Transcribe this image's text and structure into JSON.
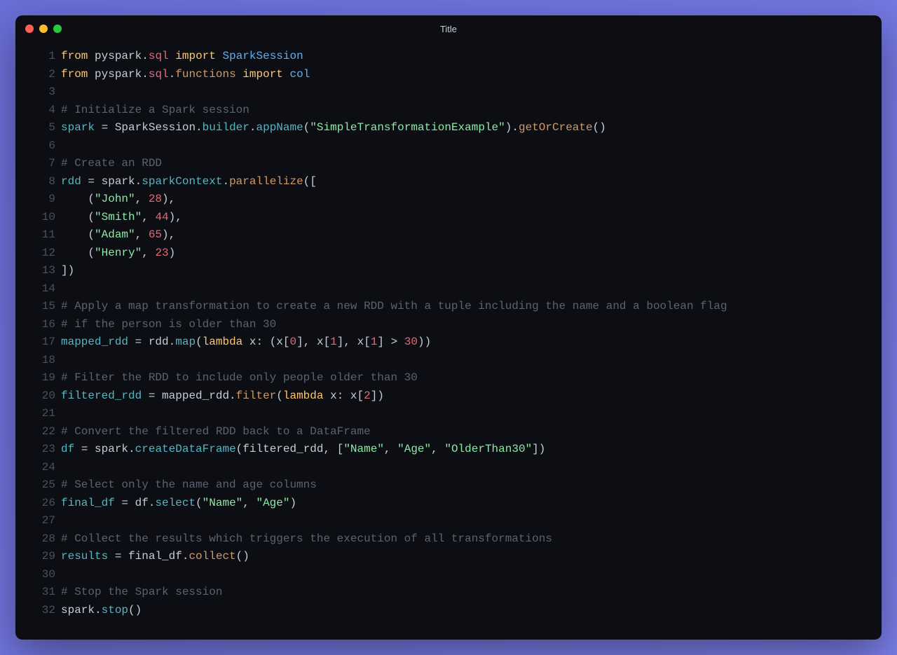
{
  "window": {
    "title": "Title"
  },
  "colors": {
    "bg": "#0d0e14",
    "gutter": "#4a5160",
    "comment": "#5c6370",
    "keyword": "#ffc66d",
    "string": "#8be9a5",
    "number": "#e06c75",
    "teal": "#56b6c2",
    "blue": "#61afef",
    "orange": "#d19a66",
    "default": "#c8ccd4"
  },
  "code": {
    "lines": [
      [
        {
          "t": "from ",
          "c": "kw"
        },
        {
          "t": "pyspark",
          "c": "mod"
        },
        {
          "t": ".",
          "c": "punct"
        },
        {
          "t": "sql",
          "c": "prop"
        },
        {
          "t": " ",
          "c": "mod"
        },
        {
          "t": "import ",
          "c": "kw"
        },
        {
          "t": "SparkSession",
          "c": "cls"
        }
      ],
      [
        {
          "t": "from ",
          "c": "kw"
        },
        {
          "t": "pyspark",
          "c": "mod"
        },
        {
          "t": ".",
          "c": "punct"
        },
        {
          "t": "sql",
          "c": "prop"
        },
        {
          "t": ".",
          "c": "punct"
        },
        {
          "t": "functions",
          "c": "attr2"
        },
        {
          "t": " ",
          "c": "mod"
        },
        {
          "t": "import ",
          "c": "kw"
        },
        {
          "t": "col",
          "c": "cls"
        }
      ],
      [],
      [
        {
          "t": "# Initialize a Spark session",
          "c": "comment"
        }
      ],
      [
        {
          "t": "spark",
          "c": "var"
        },
        {
          "t": " = ",
          "c": "mod"
        },
        {
          "t": "SparkSession",
          "c": "mod"
        },
        {
          "t": ".",
          "c": "punct"
        },
        {
          "t": "builder",
          "c": "attr"
        },
        {
          "t": ".",
          "c": "punct"
        },
        {
          "t": "appName",
          "c": "attr"
        },
        {
          "t": "(",
          "c": "punct"
        },
        {
          "t": "\"SimpleTransformationExample\"",
          "c": "str"
        },
        {
          "t": ")",
          "c": "punct"
        },
        {
          "t": ".",
          "c": "punct"
        },
        {
          "t": "getOrCreate",
          "c": "attr2"
        },
        {
          "t": "()",
          "c": "punct"
        }
      ],
      [],
      [
        {
          "t": "# Create an RDD",
          "c": "comment"
        }
      ],
      [
        {
          "t": "rdd",
          "c": "var"
        },
        {
          "t": " = ",
          "c": "mod"
        },
        {
          "t": "spark",
          "c": "mod"
        },
        {
          "t": ".",
          "c": "punct"
        },
        {
          "t": "sparkContext",
          "c": "attr"
        },
        {
          "t": ".",
          "c": "punct"
        },
        {
          "t": "parallelize",
          "c": "attr2"
        },
        {
          "t": "([",
          "c": "punct"
        }
      ],
      [
        {
          "t": "    (",
          "c": "punct"
        },
        {
          "t": "\"John\"",
          "c": "str"
        },
        {
          "t": ", ",
          "c": "punct"
        },
        {
          "t": "28",
          "c": "num"
        },
        {
          "t": "),",
          "c": "punct"
        }
      ],
      [
        {
          "t": "    (",
          "c": "punct"
        },
        {
          "t": "\"Smith\"",
          "c": "str"
        },
        {
          "t": ", ",
          "c": "punct"
        },
        {
          "t": "44",
          "c": "num"
        },
        {
          "t": "),",
          "c": "punct"
        }
      ],
      [
        {
          "t": "    (",
          "c": "punct"
        },
        {
          "t": "\"Adam\"",
          "c": "str"
        },
        {
          "t": ", ",
          "c": "punct"
        },
        {
          "t": "65",
          "c": "num"
        },
        {
          "t": "),",
          "c": "punct"
        }
      ],
      [
        {
          "t": "    (",
          "c": "punct"
        },
        {
          "t": "\"Henry\"",
          "c": "str"
        },
        {
          "t": ", ",
          "c": "punct"
        },
        {
          "t": "23",
          "c": "num"
        },
        {
          "t": ")",
          "c": "punct"
        }
      ],
      [
        {
          "t": "])",
          "c": "punct"
        }
      ],
      [],
      [
        {
          "t": "# Apply a map transformation to create a new RDD with a tuple including the name and a boolean flag",
          "c": "comment"
        }
      ],
      [
        {
          "t": "# if the person is older than 30",
          "c": "comment"
        }
      ],
      [
        {
          "t": "mapped_rdd",
          "c": "var"
        },
        {
          "t": " = ",
          "c": "mod"
        },
        {
          "t": "rdd",
          "c": "mod"
        },
        {
          "t": ".",
          "c": "punct"
        },
        {
          "t": "map",
          "c": "attr"
        },
        {
          "t": "(",
          "c": "punct"
        },
        {
          "t": "lambda ",
          "c": "kw"
        },
        {
          "t": "x",
          "c": "mod"
        },
        {
          "t": ": (",
          "c": "punct"
        },
        {
          "t": "x",
          "c": "mod"
        },
        {
          "t": "[",
          "c": "punct"
        },
        {
          "t": "0",
          "c": "num"
        },
        {
          "t": "], ",
          "c": "punct"
        },
        {
          "t": "x",
          "c": "mod"
        },
        {
          "t": "[",
          "c": "punct"
        },
        {
          "t": "1",
          "c": "num"
        },
        {
          "t": "], ",
          "c": "punct"
        },
        {
          "t": "x",
          "c": "mod"
        },
        {
          "t": "[",
          "c": "punct"
        },
        {
          "t": "1",
          "c": "num"
        },
        {
          "t": "] > ",
          "c": "punct"
        },
        {
          "t": "30",
          "c": "num"
        },
        {
          "t": "))",
          "c": "punct"
        }
      ],
      [],
      [
        {
          "t": "# Filter the RDD to include only people older than 30",
          "c": "comment"
        }
      ],
      [
        {
          "t": "filtered_rdd",
          "c": "var"
        },
        {
          "t": " = ",
          "c": "mod"
        },
        {
          "t": "mapped_rdd",
          "c": "mod"
        },
        {
          "t": ".",
          "c": "punct"
        },
        {
          "t": "filter",
          "c": "attr2"
        },
        {
          "t": "(",
          "c": "punct"
        },
        {
          "t": "lambda ",
          "c": "kw"
        },
        {
          "t": "x",
          "c": "mod"
        },
        {
          "t": ": ",
          "c": "punct"
        },
        {
          "t": "x",
          "c": "mod"
        },
        {
          "t": "[",
          "c": "punct"
        },
        {
          "t": "2",
          "c": "num"
        },
        {
          "t": "])",
          "c": "punct"
        }
      ],
      [],
      [
        {
          "t": "# Convert the filtered RDD back to a DataFrame",
          "c": "comment"
        }
      ],
      [
        {
          "t": "df",
          "c": "var"
        },
        {
          "t": " = ",
          "c": "mod"
        },
        {
          "t": "spark",
          "c": "mod"
        },
        {
          "t": ".",
          "c": "punct"
        },
        {
          "t": "createDataFrame",
          "c": "attr"
        },
        {
          "t": "(",
          "c": "punct"
        },
        {
          "t": "filtered_rdd",
          "c": "mod"
        },
        {
          "t": ", [",
          "c": "punct"
        },
        {
          "t": "\"Name\"",
          "c": "str"
        },
        {
          "t": ", ",
          "c": "punct"
        },
        {
          "t": "\"Age\"",
          "c": "str"
        },
        {
          "t": ", ",
          "c": "punct"
        },
        {
          "t": "\"OlderThan30\"",
          "c": "str"
        },
        {
          "t": "])",
          "c": "punct"
        }
      ],
      [],
      [
        {
          "t": "# Select only the name and age columns",
          "c": "comment"
        }
      ],
      [
        {
          "t": "final_df",
          "c": "var"
        },
        {
          "t": " = ",
          "c": "mod"
        },
        {
          "t": "df",
          "c": "mod"
        },
        {
          "t": ".",
          "c": "punct"
        },
        {
          "t": "select",
          "c": "attr"
        },
        {
          "t": "(",
          "c": "punct"
        },
        {
          "t": "\"Name\"",
          "c": "str"
        },
        {
          "t": ", ",
          "c": "punct"
        },
        {
          "t": "\"Age\"",
          "c": "str"
        },
        {
          "t": ")",
          "c": "punct"
        }
      ],
      [],
      [
        {
          "t": "# Collect the results which triggers the execution of all transformations",
          "c": "comment"
        }
      ],
      [
        {
          "t": "results",
          "c": "var"
        },
        {
          "t": " = ",
          "c": "mod"
        },
        {
          "t": "final_df",
          "c": "mod"
        },
        {
          "t": ".",
          "c": "punct"
        },
        {
          "t": "collect",
          "c": "attr2"
        },
        {
          "t": "()",
          "c": "punct"
        }
      ],
      [],
      [
        {
          "t": "# Stop the Spark session",
          "c": "comment"
        }
      ],
      [
        {
          "t": "spark",
          "c": "mod"
        },
        {
          "t": ".",
          "c": "punct"
        },
        {
          "t": "stop",
          "c": "attr"
        },
        {
          "t": "()",
          "c": "punct"
        }
      ]
    ]
  }
}
